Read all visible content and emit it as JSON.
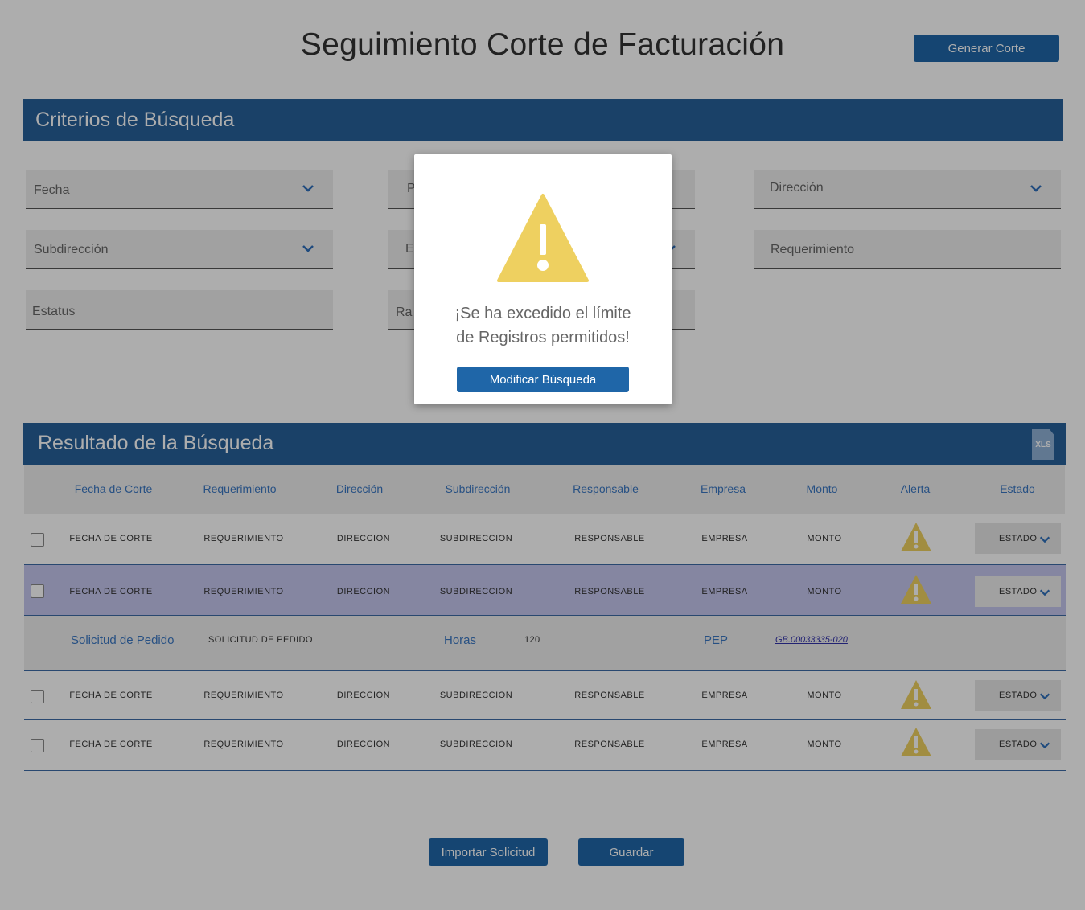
{
  "header": {
    "title": "Seguimiento Corte de Facturación",
    "generar_label": "Generar Corte"
  },
  "criteria": {
    "title": "Criterios de Búsqueda",
    "fields": {
      "fecha": "Fecha",
      "hidden_p": "P",
      "direccion": "Dirección",
      "subdireccion": "Subdirección",
      "hidden_e": "E",
      "requerimiento": "Requerimiento",
      "estatus": "Estatus",
      "hidden_ra": "Ra"
    }
  },
  "results": {
    "title": "Resultado de la Búsqueda",
    "export_label": "XLS",
    "columns": [
      "Fecha de Corte",
      "Requerimiento",
      "Dirección",
      "Subdirección",
      "Responsable",
      "Empresa",
      "Monto",
      "Alerta",
      "Estado"
    ],
    "rows": [
      {
        "fecha": "FECHA DE CORTE",
        "req": "REQUERIMIENTO",
        "dir": "DIRECCION",
        "sub": "SUBDIRECCION",
        "resp": "RESPONSABLE",
        "emp": "EMPRESA",
        "monto": "MONTO",
        "estado": "ESTADO"
      },
      {
        "fecha": "FECHA DE CORTE",
        "req": "REQUERIMIENTO",
        "dir": "DIRECCION",
        "sub": "SUBDIRECCION",
        "resp": "RESPONSABLE",
        "emp": "EMPRESA",
        "monto": "MONTO",
        "estado": "ESTADO"
      },
      {
        "fecha": "FECHA DE CORTE",
        "req": "REQUERIMIENTO",
        "dir": "DIRECCION",
        "sub": "SUBDIRECCION",
        "resp": "RESPONSABLE",
        "emp": "EMPRESA",
        "monto": "MONTO",
        "estado": "ESTADO"
      },
      {
        "fecha": "FECHA DE CORTE",
        "req": "REQUERIMIENTO",
        "dir": "DIRECCION",
        "sub": "SUBDIRECCION",
        "resp": "RESPONSABLE",
        "emp": "EMPRESA",
        "monto": "MONTO",
        "estado": "ESTADO"
      }
    ],
    "detail": {
      "solicitud_label": "Solicitud de Pedido",
      "solicitud_value": "SOLICITUD DE PEDIDO",
      "horas_label": "Horas",
      "horas_value": "120",
      "pep_label": "PEP",
      "pep_value": "GB.00033335-020"
    }
  },
  "actions": {
    "importar_label": "Importar Solicitud",
    "guardar_label": "Guardar"
  },
  "modal": {
    "line1": "¡Se ha excedido el límite",
    "line2": "de Registros permitidos!",
    "button_label": "Modificar Búsqueda"
  },
  "colors": {
    "primary": "#1f66a8",
    "band": "#27609a",
    "warning": "#eed060",
    "highlight_row": "#c4c6ee"
  }
}
